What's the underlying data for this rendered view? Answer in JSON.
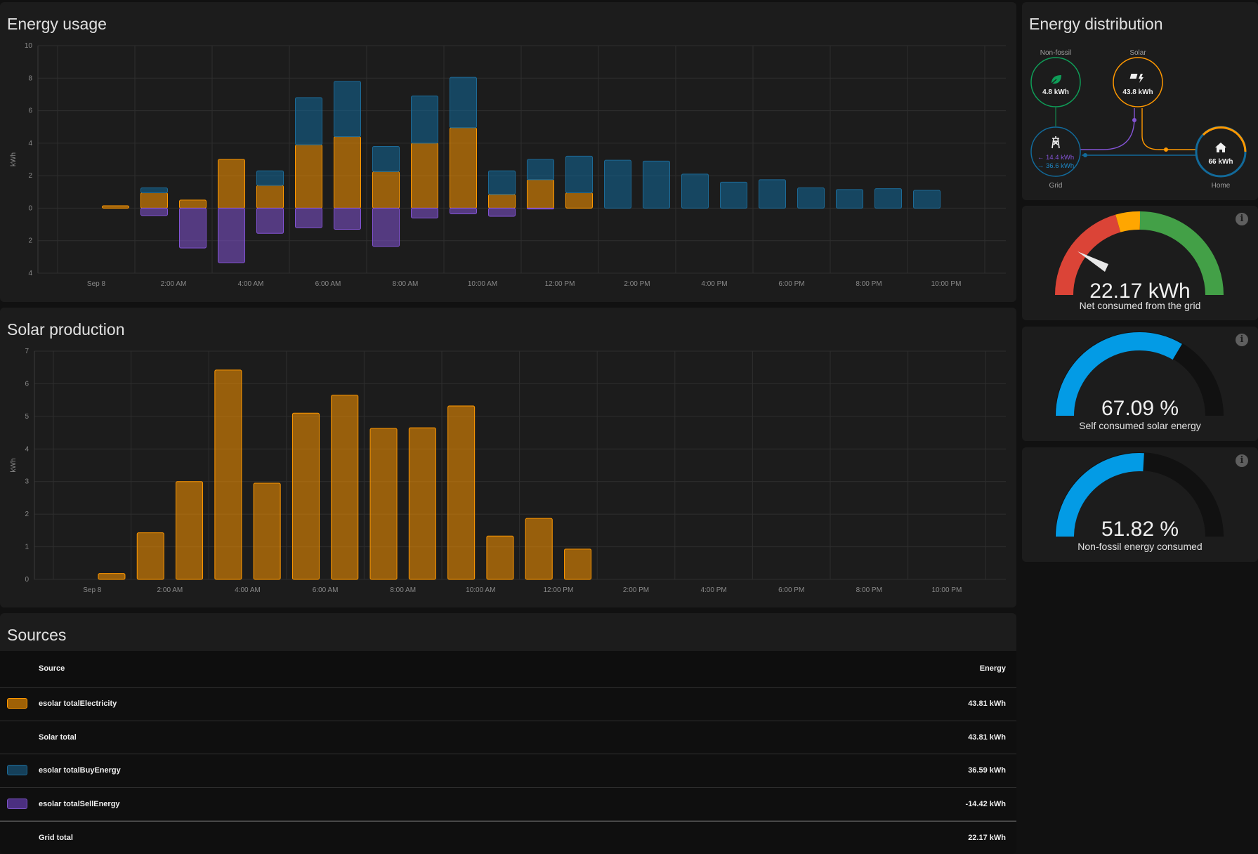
{
  "energy_usage": {
    "title": "Energy usage",
    "y_unit": "kWh",
    "y_ticks": [
      "10",
      "8",
      "6",
      "4",
      "2",
      "0",
      "2",
      "4"
    ],
    "x_ticks": [
      "Sep 8",
      "2:00 AM",
      "4:00 AM",
      "6:00 AM",
      "8:00 AM",
      "10:00 AM",
      "12:00 PM",
      "2:00 PM",
      "4:00 PM",
      "6:00 PM",
      "8:00 PM",
      "10:00 PM"
    ]
  },
  "solar_production": {
    "title": "Solar production",
    "y_unit": "kWh",
    "y_ticks": [
      "7",
      "6",
      "5",
      "4",
      "3",
      "2",
      "1",
      "0"
    ],
    "x_ticks": [
      "Sep 8",
      "2:00 AM",
      "4:00 AM",
      "6:00 AM",
      "8:00 AM",
      "10:00 AM",
      "12:00 PM",
      "2:00 PM",
      "4:00 PM",
      "6:00 PM",
      "8:00 PM",
      "10:00 PM"
    ]
  },
  "chart_data": [
    {
      "type": "bar",
      "title": "Energy usage",
      "ylabel": "kWh",
      "ylim": [
        -4,
        10
      ],
      "categories": [
        "12 AM",
        "1 AM",
        "2 AM",
        "3 AM",
        "4 AM",
        "5 AM",
        "6 AM",
        "7 AM",
        "8 AM",
        "9 AM",
        "10 AM",
        "11 AM",
        "12 PM",
        "1 PM",
        "2 PM",
        "3 PM",
        "4 PM",
        "5 PM",
        "6 PM",
        "7 PM",
        "8 PM",
        "9 PM",
        "10 PM",
        "11 PM"
      ],
      "series": [
        {
          "name": "esolar totalElectricity",
          "values": [
            0,
            0.15,
            0.95,
            0.5,
            3.0,
            1.4,
            3.9,
            4.4,
            2.25,
            4.0,
            4.95,
            0.85,
            1.75,
            0.95,
            0,
            0,
            0,
            0,
            0,
            0,
            0,
            0,
            0,
            0
          ]
        },
        {
          "name": "esolar totalBuyEnergy",
          "values": [
            0,
            0,
            0.3,
            0,
            0,
            0.9,
            2.9,
            3.4,
            1.55,
            2.9,
            3.1,
            1.45,
            1.25,
            2.25,
            2.95,
            2.9,
            2.1,
            1.6,
            1.75,
            1.25,
            1.15,
            1.2,
            1.1,
            0
          ]
        },
        {
          "name": "esolar totalSellEnergy",
          "values": [
            0,
            0,
            -0.45,
            -2.45,
            -3.35,
            -1.55,
            -1.2,
            -1.3,
            -2.35,
            -0.6,
            -0.35,
            -0.5,
            -0.05,
            0,
            0,
            0,
            0,
            0,
            0,
            0,
            0,
            0,
            0,
            0
          ]
        }
      ]
    },
    {
      "type": "bar",
      "title": "Solar production",
      "ylabel": "kWh",
      "ylim": [
        0,
        7
      ],
      "categories": [
        "12 AM",
        "1 AM",
        "2 AM",
        "3 AM",
        "4 AM",
        "5 AM",
        "6 AM",
        "7 AM",
        "8 AM",
        "9 AM",
        "10 AM",
        "11 AM",
        "12 PM",
        "1 PM",
        "2 PM",
        "3 PM",
        "4 PM",
        "5 PM",
        "6 PM",
        "7 PM",
        "8 PM",
        "9 PM",
        "10 PM",
        "11 PM"
      ],
      "series": [
        {
          "name": "esolar totalElectricity",
          "values": [
            0,
            0.18,
            1.43,
            3.0,
            6.42,
            2.95,
            5.1,
            5.65,
            4.63,
            4.65,
            5.32,
            1.33,
            1.87,
            0.93,
            0,
            0,
            0,
            0,
            0,
            0,
            0,
            0,
            0,
            0
          ]
        }
      ]
    }
  ],
  "distribution": {
    "title": "Energy distribution",
    "nonfossil": {
      "label": "Non-fossil",
      "value": "4.8 kWh"
    },
    "solar": {
      "label": "Solar",
      "value": "43.8 kWh"
    },
    "grid": {
      "label": "Grid",
      "in": "← 14.4 kWh",
      "out": "→ 36.6 kWh"
    },
    "home": {
      "label": "Home",
      "value": "66 kWh"
    }
  },
  "gauges": [
    {
      "value": "22.17 kWh",
      "label": "Net consumed from the grid",
      "info": "i"
    },
    {
      "value": "67.09 %",
      "label": "Self consumed solar energy",
      "level": 0.6709,
      "info": "i"
    },
    {
      "value": "51.82 %",
      "label": "Non-fossil energy consumed",
      "level": 0.5182,
      "info": "i"
    }
  ],
  "sources": {
    "title": "Sources",
    "header": {
      "source": "Source",
      "energy": "Energy"
    },
    "rows": [
      {
        "name": "esolar totalElectricity",
        "energy": "43.81 kWh",
        "color": "#ff9800"
      },
      {
        "name": "Solar total",
        "energy": "43.81 kWh"
      },
      {
        "name": "esolar totalBuyEnergy",
        "energy": "36.59 kWh",
        "color": "#126a9a"
      },
      {
        "name": "esolar totalSellEnergy",
        "energy": "-14.42 kWh",
        "color": "#a280db"
      },
      {
        "name": "Grid total",
        "energy": "22.17 kWh"
      }
    ]
  },
  "colors": {
    "solar": "#ff9800",
    "grid_buy": "#126a9a",
    "grid_sell": "#8353d4",
    "nonfossil": "#0f9d58",
    "gauge_blue": "#039be5",
    "gauge_red": "#db4437",
    "gauge_orange": "#ffa600",
    "gauge_green": "#43a047"
  }
}
